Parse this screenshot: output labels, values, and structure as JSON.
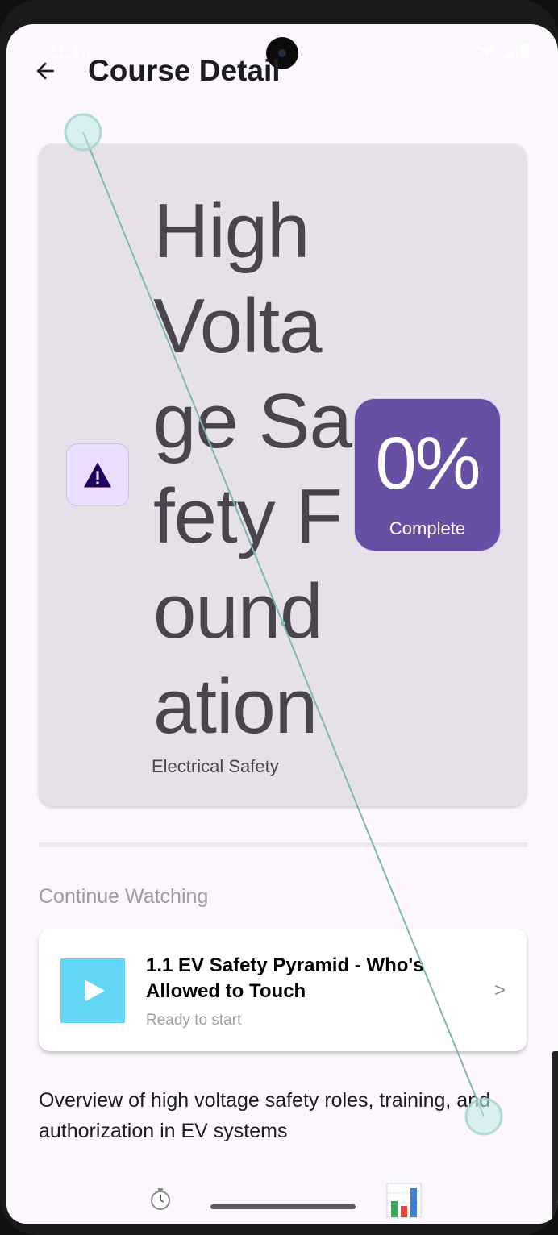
{
  "status_bar": {
    "time": "11:14"
  },
  "top_bar": {
    "title": "Course Detail"
  },
  "course": {
    "title": "High Voltage Safety Foundation",
    "category": "Electrical Safety",
    "icon": "warning-icon",
    "progress": {
      "value": "0%",
      "label": "Complete",
      "fraction": 0
    }
  },
  "continue_section": {
    "title": "Continue Watching",
    "lesson": {
      "title": "1.1 EV Safety Pyramid - Who's Allowed to Touch",
      "status": "Ready to start",
      "chevron": ">"
    }
  },
  "description": "Overview of high voltage safety roles, training, and authorization in EV systems",
  "bottom_nav": {
    "items": [
      "timer-icon",
      "chart-icon"
    ]
  },
  "colors": {
    "primary": "#6750a4",
    "card": "#e6e0e9",
    "thumb": "#62d6f5",
    "background": "#fcf7fd"
  }
}
